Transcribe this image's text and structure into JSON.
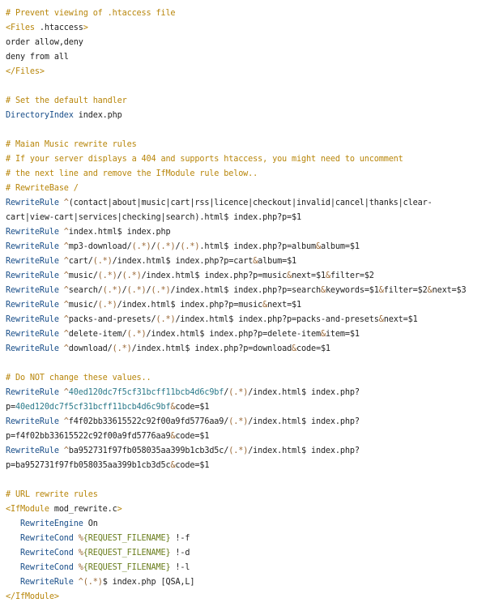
{
  "colors": {
    "background": "#ffffff",
    "comment": "#b8860b",
    "directive": "#1a4f8a",
    "tag": "#b8860b",
    "pattern": "#996633",
    "variable": "#6a7d1d",
    "hash": "#2b7a8a",
    "text": "#222222"
  },
  "lines": [
    [
      {
        "t": "# Prevent viewing of .htaccess file",
        "c": "cmt"
      }
    ],
    [
      {
        "t": "<Files",
        "c": "tag"
      },
      {
        "t": " .htaccess",
        "c": "plain"
      },
      {
        "t": ">",
        "c": "tag"
      }
    ],
    [
      {
        "t": "order allow,deny",
        "c": "plain"
      }
    ],
    [
      {
        "t": "deny from all",
        "c": "plain"
      }
    ],
    [
      {
        "t": "</Files>",
        "c": "tag"
      }
    ],
    [
      {
        "t": "",
        "c": "plain"
      }
    ],
    [
      {
        "t": "# Set the default handler",
        "c": "cmt"
      }
    ],
    [
      {
        "t": "DirectoryIndex",
        "c": "kw"
      },
      {
        "t": " index.php",
        "c": "plain"
      }
    ],
    [
      {
        "t": "",
        "c": "plain"
      }
    ],
    [
      {
        "t": "# Maian Music rewrite rules",
        "c": "cmt"
      }
    ],
    [
      {
        "t": "# If your server displays a 404 and supports htaccess, you might need to uncomment",
        "c": "cmt"
      }
    ],
    [
      {
        "t": "# the next line and remove the IfModule rule below..",
        "c": "cmt"
      }
    ],
    [
      {
        "t": "# RewriteBase /",
        "c": "cmt"
      }
    ],
    [
      {
        "t": "RewriteRule",
        "c": "kw"
      },
      {
        "t": " ^",
        "c": "mut"
      },
      {
        "t": "(contact|about|music|cart|rss|licence|checkout|invalid|cancel|thanks|clear-",
        "c": "plain"
      }
    ],
    [
      {
        "t": "cart|view-cart|services|checking|search).html$ index.php?p=$1",
        "c": "plain"
      }
    ],
    [
      {
        "t": "RewriteRule",
        "c": "kw"
      },
      {
        "t": " ^",
        "c": "mut"
      },
      {
        "t": "index.html$ index.php",
        "c": "plain"
      }
    ],
    [
      {
        "t": "RewriteRule",
        "c": "kw"
      },
      {
        "t": " ^",
        "c": "mut"
      },
      {
        "t": "mp3-download/",
        "c": "plain"
      },
      {
        "t": "(.*)",
        "c": "mut"
      },
      {
        "t": "/",
        "c": "plain"
      },
      {
        "t": "(.*)",
        "c": "mut"
      },
      {
        "t": "/",
        "c": "plain"
      },
      {
        "t": "(.*)",
        "c": "mut"
      },
      {
        "t": ".html$ index.php?p=album",
        "c": "plain"
      },
      {
        "t": "&",
        "c": "mut"
      },
      {
        "t": "album=$1",
        "c": "plain"
      }
    ],
    [
      {
        "t": "RewriteRule",
        "c": "kw"
      },
      {
        "t": " ^",
        "c": "mut"
      },
      {
        "t": "cart/",
        "c": "plain"
      },
      {
        "t": "(.*)",
        "c": "mut"
      },
      {
        "t": "/index.html$ index.php?p=cart",
        "c": "plain"
      },
      {
        "t": "&",
        "c": "mut"
      },
      {
        "t": "album=$1",
        "c": "plain"
      }
    ],
    [
      {
        "t": "RewriteRule",
        "c": "kw"
      },
      {
        "t": " ^",
        "c": "mut"
      },
      {
        "t": "music/",
        "c": "plain"
      },
      {
        "t": "(.*)",
        "c": "mut"
      },
      {
        "t": "/",
        "c": "plain"
      },
      {
        "t": "(.*)",
        "c": "mut"
      },
      {
        "t": "/index.html$ index.php?p=music",
        "c": "plain"
      },
      {
        "t": "&",
        "c": "mut"
      },
      {
        "t": "next=$1",
        "c": "plain"
      },
      {
        "t": "&",
        "c": "mut"
      },
      {
        "t": "filter=$2",
        "c": "plain"
      }
    ],
    [
      {
        "t": "RewriteRule",
        "c": "kw"
      },
      {
        "t": " ^",
        "c": "mut"
      },
      {
        "t": "search/",
        "c": "plain"
      },
      {
        "t": "(.*)",
        "c": "mut"
      },
      {
        "t": "/",
        "c": "plain"
      },
      {
        "t": "(.*)",
        "c": "mut"
      },
      {
        "t": "/",
        "c": "plain"
      },
      {
        "t": "(.*)",
        "c": "mut"
      },
      {
        "t": "/index.html$ index.php?p=search",
        "c": "plain"
      },
      {
        "t": "&",
        "c": "mut"
      },
      {
        "t": "keywords=$1",
        "c": "plain"
      },
      {
        "t": "&",
        "c": "mut"
      },
      {
        "t": "filter=$2",
        "c": "plain"
      },
      {
        "t": "&",
        "c": "mut"
      },
      {
        "t": "next=$3",
        "c": "plain"
      }
    ],
    [
      {
        "t": "RewriteRule",
        "c": "kw"
      },
      {
        "t": " ^",
        "c": "mut"
      },
      {
        "t": "music/",
        "c": "plain"
      },
      {
        "t": "(.*)",
        "c": "mut"
      },
      {
        "t": "/index.html$ index.php?p=music",
        "c": "plain"
      },
      {
        "t": "&",
        "c": "mut"
      },
      {
        "t": "next=$1",
        "c": "plain"
      }
    ],
    [
      {
        "t": "RewriteRule",
        "c": "kw"
      },
      {
        "t": " ^",
        "c": "mut"
      },
      {
        "t": "packs-and-presets/",
        "c": "plain"
      },
      {
        "t": "(.*)",
        "c": "mut"
      },
      {
        "t": "/index.html$ index.php?p=packs-and-presets",
        "c": "plain"
      },
      {
        "t": "&",
        "c": "mut"
      },
      {
        "t": "next=$1",
        "c": "plain"
      }
    ],
    [
      {
        "t": "RewriteRule",
        "c": "kw"
      },
      {
        "t": " ^",
        "c": "mut"
      },
      {
        "t": "delete-item/",
        "c": "plain"
      },
      {
        "t": "(.*)",
        "c": "mut"
      },
      {
        "t": "/index.html$ index.php?p=delete-item",
        "c": "plain"
      },
      {
        "t": "&",
        "c": "mut"
      },
      {
        "t": "item=$1",
        "c": "plain"
      }
    ],
    [
      {
        "t": "RewriteRule",
        "c": "kw"
      },
      {
        "t": " ^",
        "c": "mut"
      },
      {
        "t": "download/",
        "c": "plain"
      },
      {
        "t": "(.*)",
        "c": "mut"
      },
      {
        "t": "/index.html$ index.php?p=download",
        "c": "plain"
      },
      {
        "t": "&",
        "c": "mut"
      },
      {
        "t": "code=$1",
        "c": "plain"
      }
    ],
    [
      {
        "t": "",
        "c": "plain"
      }
    ],
    [
      {
        "t": "# Do NOT change these values..",
        "c": "cmt"
      }
    ],
    [
      {
        "t": "RewriteRule",
        "c": "kw"
      },
      {
        "t": " ^",
        "c": "mut"
      },
      {
        "t": "40ed120dc7f5cf31bcff11bcb4d6c9bf",
        "c": "hash"
      },
      {
        "t": "/",
        "c": "plain"
      },
      {
        "t": "(.*)",
        "c": "mut"
      },
      {
        "t": "/index.html$ index.php?",
        "c": "plain"
      }
    ],
    [
      {
        "t": "p=",
        "c": "plain"
      },
      {
        "t": "40ed120dc7f5cf31bcff11bcb4d6c9bf",
        "c": "hash"
      },
      {
        "t": "&",
        "c": "mut"
      },
      {
        "t": "code=$1",
        "c": "plain"
      }
    ],
    [
      {
        "t": "RewriteRule",
        "c": "kw"
      },
      {
        "t": " ^",
        "c": "mut"
      },
      {
        "t": "f4f02bb33615522c92f00a9fd5776aa9/",
        "c": "plain"
      },
      {
        "t": "(.*)",
        "c": "mut"
      },
      {
        "t": "/index.html$ index.php?",
        "c": "plain"
      }
    ],
    [
      {
        "t": "p=f4f02bb33615522c92f00a9fd5776aa9",
        "c": "plain"
      },
      {
        "t": "&",
        "c": "mut"
      },
      {
        "t": "code=$1",
        "c": "plain"
      }
    ],
    [
      {
        "t": "RewriteRule",
        "c": "kw"
      },
      {
        "t": " ^",
        "c": "mut"
      },
      {
        "t": "ba952731f97fb058035aa399b1cb3d5c/",
        "c": "plain"
      },
      {
        "t": "(.*)",
        "c": "mut"
      },
      {
        "t": "/index.html$ index.php?",
        "c": "plain"
      }
    ],
    [
      {
        "t": "p=ba952731f97fb058035aa399b1cb3d5c",
        "c": "plain"
      },
      {
        "t": "&",
        "c": "mut"
      },
      {
        "t": "code=$1",
        "c": "plain"
      }
    ],
    [
      {
        "t": "",
        "c": "plain"
      }
    ],
    [
      {
        "t": "# URL rewrite rules",
        "c": "cmt"
      }
    ],
    [
      {
        "t": "<IfModule",
        "c": "tag"
      },
      {
        "t": " mod_rewrite.c",
        "c": "plain"
      },
      {
        "t": ">",
        "c": "tag"
      }
    ],
    [
      {
        "t": "   RewriteEngine",
        "c": "kw"
      },
      {
        "t": " On",
        "c": "plain"
      }
    ],
    [
      {
        "t": "   RewriteCond",
        "c": "kw"
      },
      {
        "t": " %",
        "c": "mut"
      },
      {
        "t": "{REQUEST_FILENAME}",
        "c": "var"
      },
      {
        "t": " !-f",
        "c": "plain"
      }
    ],
    [
      {
        "t": "   RewriteCond",
        "c": "kw"
      },
      {
        "t": " %",
        "c": "mut"
      },
      {
        "t": "{REQUEST_FILENAME}",
        "c": "var"
      },
      {
        "t": " !-d",
        "c": "plain"
      }
    ],
    [
      {
        "t": "   RewriteCond",
        "c": "kw"
      },
      {
        "t": " %",
        "c": "mut"
      },
      {
        "t": "{REQUEST_FILENAME}",
        "c": "var"
      },
      {
        "t": " !-l",
        "c": "plain"
      }
    ],
    [
      {
        "t": "   RewriteRule",
        "c": "kw"
      },
      {
        "t": " ^",
        "c": "mut"
      },
      {
        "t": "(.*)",
        "c": "mut"
      },
      {
        "t": "$ index.php [QSA,L]",
        "c": "plain"
      }
    ],
    [
      {
        "t": "</IfModule>",
        "c": "tag"
      }
    ]
  ]
}
